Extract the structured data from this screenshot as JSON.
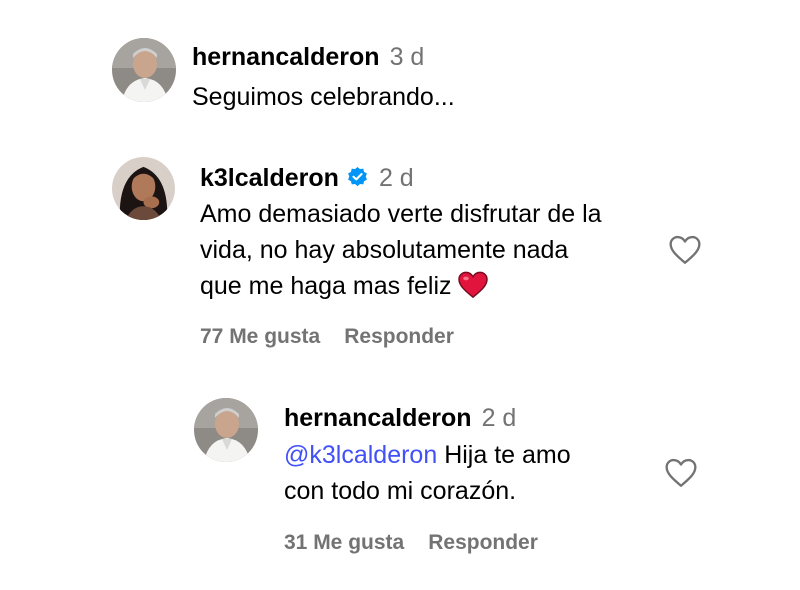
{
  "comment": {
    "username": "hernancalderon",
    "time": "3 d",
    "text": "Seguimos celebrando..."
  },
  "reply1": {
    "username": "k3lcalderon",
    "verified": true,
    "time": "2 d",
    "text_lines": [
      "Amo demasiado verte disfrutar de la",
      "vida, no hay absolutamente nada",
      "que me haga mas feliz"
    ],
    "emoji": "red-heart",
    "likes_label": "77 Me gusta",
    "reply_label": "Responder"
  },
  "reply2": {
    "username": "hernancalderon",
    "time": "2 d",
    "mention": "@k3lcalderon",
    "text_line1": "Hija te amo",
    "text_line2": "con todo mi corazón.",
    "likes_label": "31 Me gusta",
    "reply_label": "Responder"
  },
  "colors": {
    "secondary_text": "#737373",
    "mention": "#4150f7",
    "verified_badge": "#0095f6",
    "heart_emoji": "#e0143c"
  },
  "icons": {
    "like": "heart-outline-icon",
    "verified": "verified-badge-icon"
  }
}
